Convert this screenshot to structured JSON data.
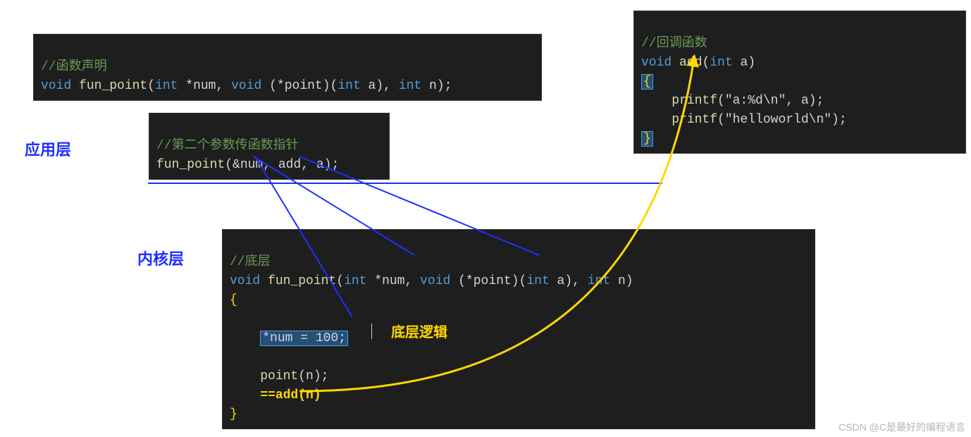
{
  "labels": {
    "app_layer": "应用层",
    "kernel_layer": "内核层",
    "low_logic": "底层逻辑"
  },
  "box1": {
    "comment": "//函数声明",
    "line": {
      "p1": "void",
      "p2": " fun_point",
      "p3": "(",
      "p4": "int",
      "p5": " *num, ",
      "p6": "void",
      "p7": " (*point)(",
      "p8": "int",
      "p9": " a), ",
      "p10": "int",
      "p11": " n);"
    }
  },
  "box2": {
    "comment": "//第二个参数传函数指针",
    "line": {
      "p1": "fun_point",
      "p2": "(&num, add, a);"
    }
  },
  "box3": {
    "comment": "//底层",
    "sig": {
      "p1": "void",
      "p2": " fun_point",
      "p3": "(",
      "p4": "int",
      "p5": " *num, ",
      "p6": "void",
      "p7": " (*point)(",
      "p8": "int",
      "p9": " a), ",
      "p10": "int",
      "p11": " n)"
    },
    "ob": "{",
    "stmt1": "*num = 100;",
    "call": {
      "p1": "point",
      "p2": "(n);"
    },
    "eq": "==add(n)",
    "cb": "}"
  },
  "box4": {
    "comment": "//回调函数",
    "sig": {
      "p1": "void",
      "p2": " add",
      "p3": "(",
      "p4": "int",
      "p5": " a)"
    },
    "ob": "{",
    "l1": {
      "p1": "    printf",
      "p2": "(\"a:%d\\n\", a);"
    },
    "l2": {
      "p1": "    printf",
      "p2": "(\"helloworld\\n\");"
    },
    "cb": "}"
  },
  "watermark": "CSDN @C是最好的编程语言"
}
